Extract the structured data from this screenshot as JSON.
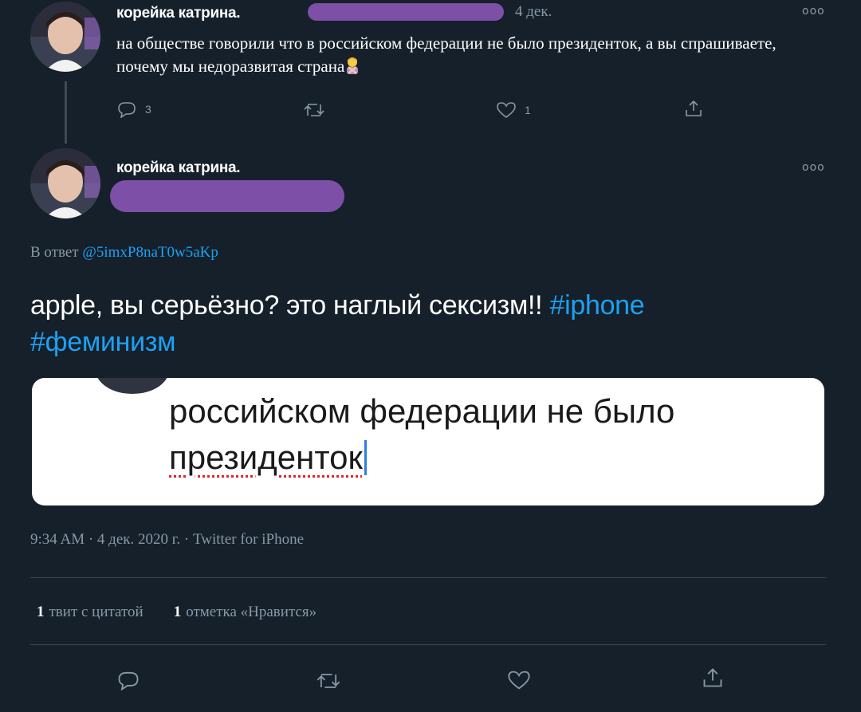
{
  "first_tweet": {
    "display_name": "корейка катрина.",
    "time_ago": "4 дек.",
    "text": "на обществе говорили что в российском федерации не было президенток, а вы спрашиваете, почему мы недоразвитая страна",
    "actions": {
      "reply_count": "3",
      "retweet_count": "",
      "like_count": "1"
    }
  },
  "main_tweet": {
    "display_name": "корейка катрина.",
    "reply_to_prefix": "В ответ",
    "reply_to_handle": "@5imxP8naT0w5aKp",
    "text_plain": "apple, вы серьёзно? это наглый сексизм!!",
    "hashtag_1": "#iphone",
    "hashtag_2": "#феминизм",
    "embedded_image": {
      "line1": "российском федерации не было",
      "line2": "президенток"
    },
    "meta": "9:34 AM · 4 дек. 2020 г. · Twitter for iPhone",
    "stats": {
      "quote_count": "1",
      "quote_label": "твит с цитатой",
      "like_count": "1",
      "like_label": "отметка «Нравится»"
    }
  },
  "icons": {
    "reply": "reply-icon",
    "retweet": "retweet-icon",
    "like": "heart-icon",
    "share": "share-icon",
    "more": "more-icon"
  },
  "colors": {
    "background": "#15202b",
    "accent": "#1da1f2",
    "muted": "#8899a6",
    "redaction": "#7d4fa6"
  }
}
